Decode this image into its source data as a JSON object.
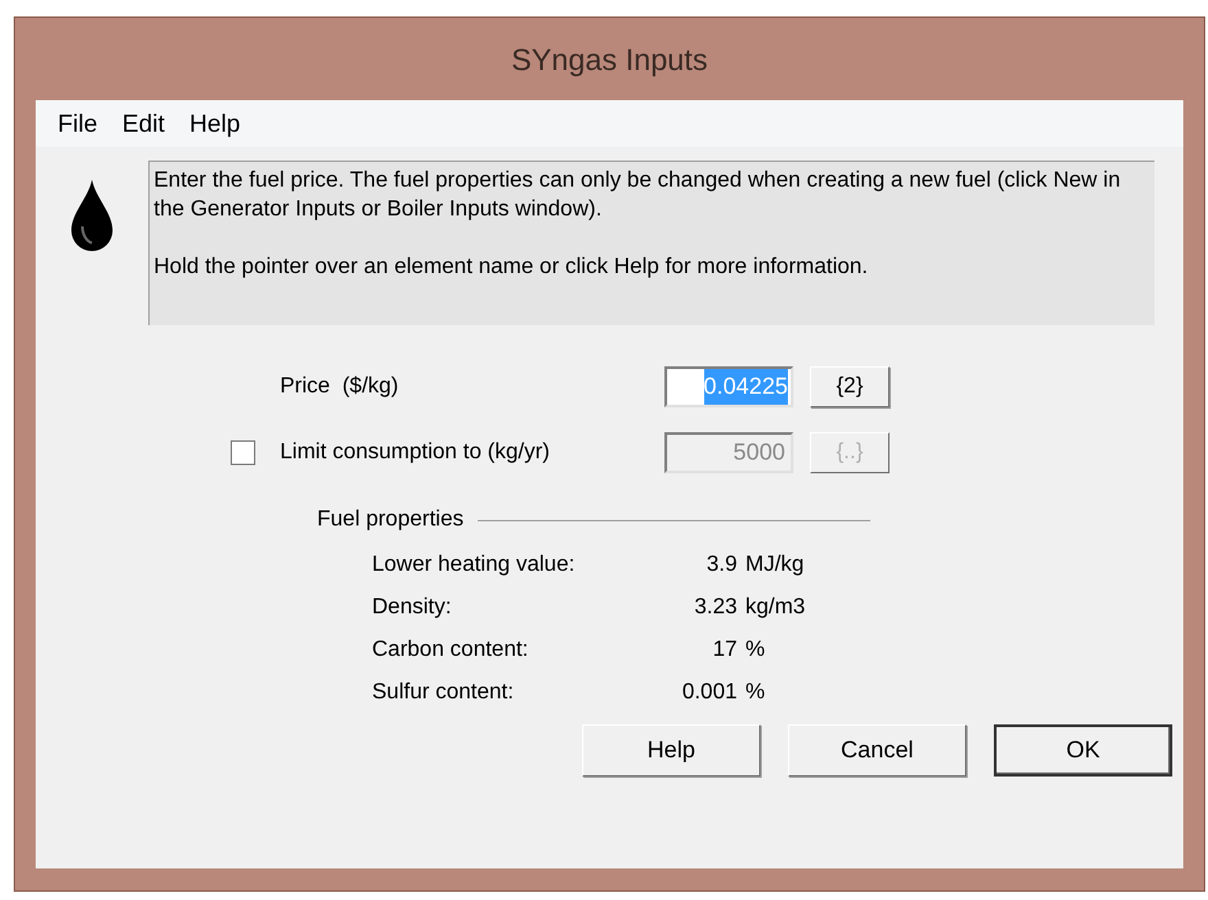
{
  "window": {
    "title": "SYngas Inputs"
  },
  "menu": [
    {
      "label": "File"
    },
    {
      "label": "Edit"
    },
    {
      "label": "Help"
    }
  ],
  "info": {
    "paragraphs": [
      "Enter the fuel price. The fuel properties can only be changed when creating a new fuel (click New in the Generator Inputs or Boiler Inputs window).",
      "Hold the pointer over an element name or click Help for more information."
    ]
  },
  "price": {
    "label": "Price  ($/kg)",
    "value": "0.04225",
    "selected": true,
    "button": "{2}"
  },
  "limit": {
    "label": "Limit consumption to (kg/yr)",
    "checked": false,
    "value": "5000",
    "disabled": true,
    "button": "{..}"
  },
  "fuel_properties": {
    "title": "Fuel properties",
    "rows": [
      {
        "label": "Lower heating value:",
        "value": "3.9",
        "unit": "MJ/kg"
      },
      {
        "label": "Density:",
        "value": "3.23",
        "unit": "kg/m3"
      },
      {
        "label": "Carbon content:",
        "value": "17",
        "unit": "%"
      },
      {
        "label": "Sulfur content:",
        "value": "0.001",
        "unit": "%"
      }
    ]
  },
  "buttons": [
    {
      "label": "Help",
      "default": false
    },
    {
      "label": "Cancel",
      "default": false
    },
    {
      "label": "OK",
      "default": true
    }
  ]
}
